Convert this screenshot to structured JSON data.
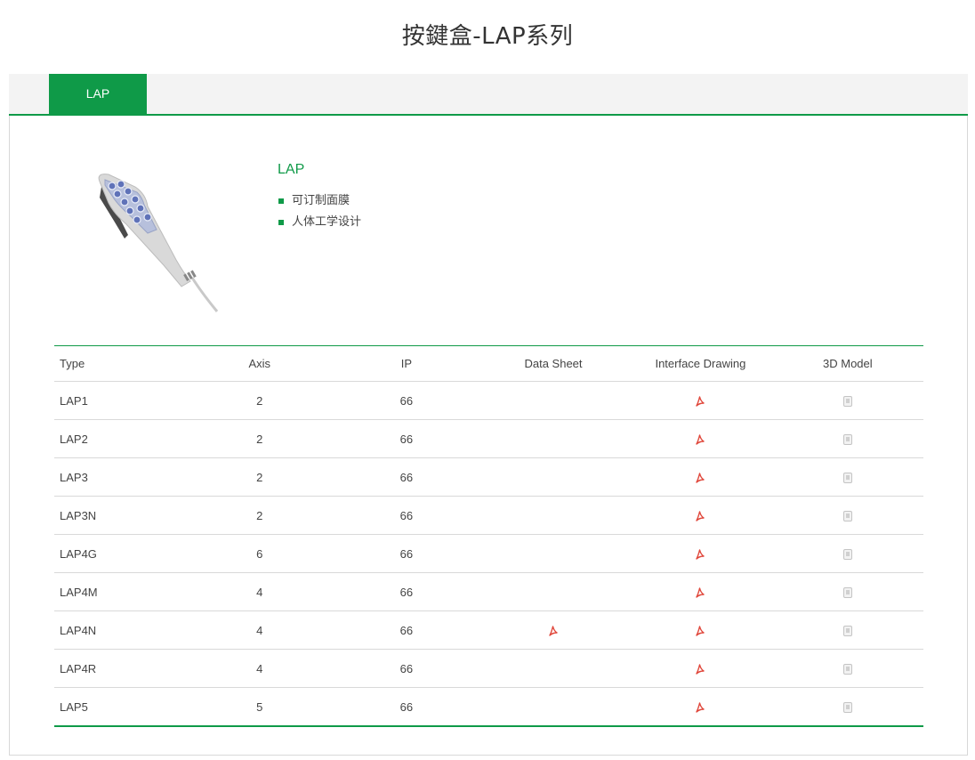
{
  "page": {
    "title": "按鍵盒-LAP系列"
  },
  "tabs": [
    {
      "label": "LAP",
      "active": true
    }
  ],
  "product": {
    "name": "LAP",
    "features": [
      "可订制面膜",
      "人体工学设计"
    ]
  },
  "table": {
    "headers": [
      "Type",
      "Axis",
      "IP",
      "Data Sheet",
      "Interface Drawing",
      "3D Model"
    ],
    "rows": [
      {
        "type": "LAP1",
        "axis": "2",
        "ip": "66",
        "data_sheet": false,
        "interface_drawing": true,
        "model_3d": true
      },
      {
        "type": "LAP2",
        "axis": "2",
        "ip": "66",
        "data_sheet": false,
        "interface_drawing": true,
        "model_3d": true
      },
      {
        "type": "LAP3",
        "axis": "2",
        "ip": "66",
        "data_sheet": false,
        "interface_drawing": true,
        "model_3d": true
      },
      {
        "type": "LAP3N",
        "axis": "2",
        "ip": "66",
        "data_sheet": false,
        "interface_drawing": true,
        "model_3d": true
      },
      {
        "type": "LAP4G",
        "axis": "6",
        "ip": "66",
        "data_sheet": false,
        "interface_drawing": true,
        "model_3d": true
      },
      {
        "type": "LAP4M",
        "axis": "4",
        "ip": "66",
        "data_sheet": false,
        "interface_drawing": true,
        "model_3d": true
      },
      {
        "type": "LAP4N",
        "axis": "4",
        "ip": "66",
        "data_sheet": true,
        "interface_drawing": true,
        "model_3d": true
      },
      {
        "type": "LAP4R",
        "axis": "4",
        "ip": "66",
        "data_sheet": false,
        "interface_drawing": true,
        "model_3d": true
      },
      {
        "type": "LAP5",
        "axis": "5",
        "ip": "66",
        "data_sheet": false,
        "interface_drawing": true,
        "model_3d": true
      }
    ]
  },
  "icons": {
    "pdf": "pdf-icon",
    "model": "model-file-icon"
  },
  "colors": {
    "accent": "#0f9a48",
    "pdf": "#e0463a",
    "model": "#bbbbbb"
  }
}
